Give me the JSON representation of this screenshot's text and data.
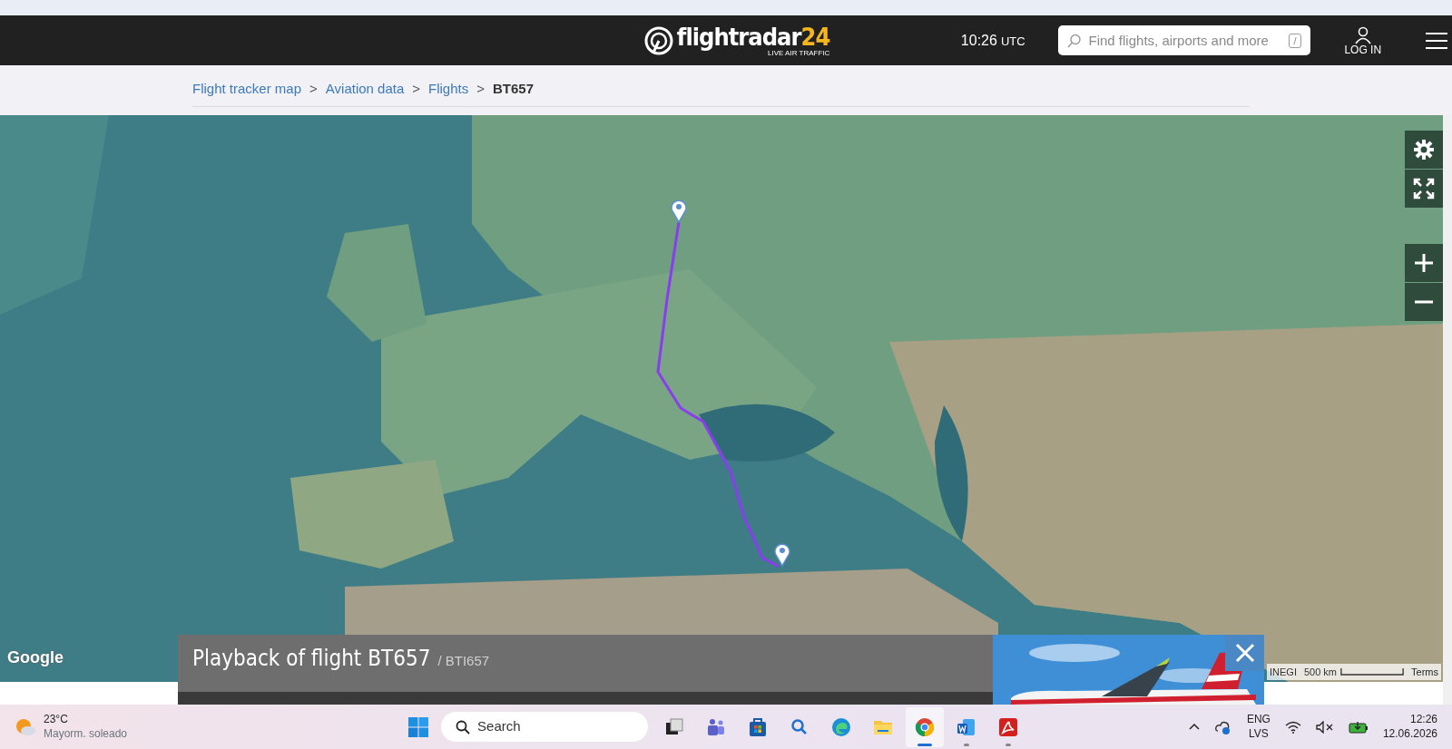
{
  "header": {
    "logo": "flightradar",
    "logo_accent": "24",
    "tagline": "LIVE AIR TRAFFIC",
    "time": "10:26",
    "time_zone": "UTC",
    "search": {
      "placeholder": "Find flights, airports and more",
      "shortcut": "/"
    },
    "login": "LOG IN"
  },
  "breadcrumb": [
    {
      "label": "Flight tracker map",
      "current": false
    },
    {
      "label": "Aviation data",
      "current": false
    },
    {
      "label": "Flights",
      "current": false
    },
    {
      "label": "BT657",
      "current": true
    }
  ],
  "breadcrumb_separator": ">",
  "map": {
    "controls": [
      {
        "kind": "settings"
      },
      {
        "kind": "fullscreen"
      },
      {
        "kind": "zoom_in"
      },
      {
        "kind": "zoom_out"
      }
    ],
    "attribution": {
      "logo": "Google",
      "source": "INEGI",
      "scale": "500 km",
      "terms": "Terms"
    }
  },
  "playback": {
    "title": "Playback of flight BT657",
    "subtitle": "/ BTI657"
  },
  "taskbar": {
    "weather": {
      "temperature": "23°C",
      "condition": "Mayorm. soleado"
    },
    "search": "Search",
    "apps": [
      {
        "kind": "taskview",
        "running": false,
        "active": false
      },
      {
        "kind": "teams",
        "running": false,
        "active": false
      },
      {
        "kind": "store",
        "running": false,
        "active": false
      },
      {
        "kind": "search",
        "running": false,
        "active": false
      },
      {
        "kind": "edge",
        "running": false,
        "active": false
      },
      {
        "kind": "files",
        "running": false,
        "active": false
      },
      {
        "kind": "chrome",
        "running": true,
        "active": true
      },
      {
        "kind": "word",
        "running": true,
        "active": false
      },
      {
        "kind": "acrobat",
        "running": true,
        "active": false
      }
    ],
    "language": "ENG",
    "layout": "LVS",
    "time": "12:26",
    "date": "12.06.2026"
  }
}
